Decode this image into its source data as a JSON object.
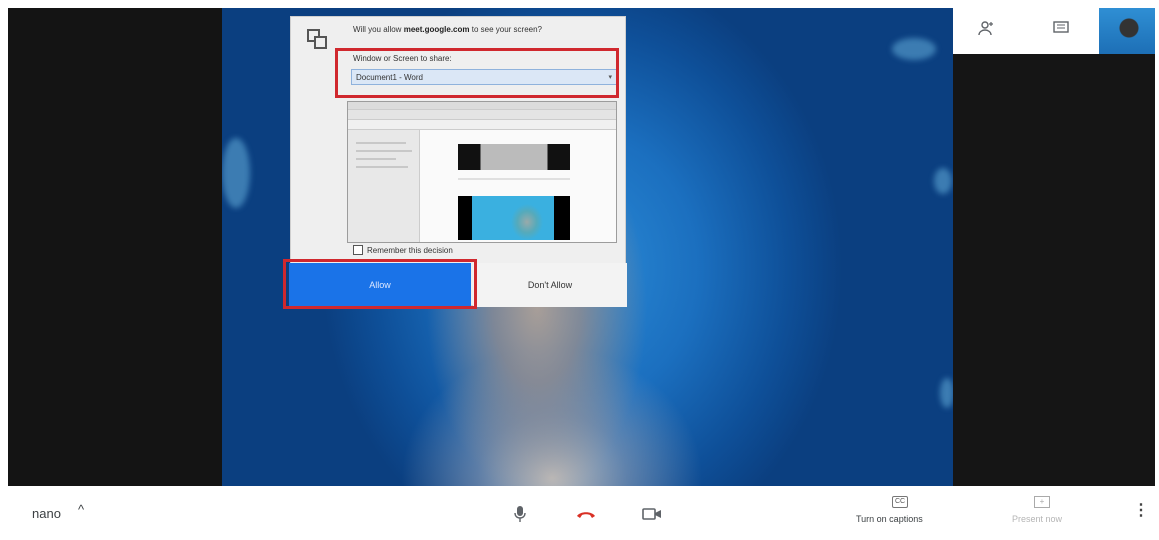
{
  "dialog": {
    "question_prefix": "Will you allow",
    "question_site": "meet.google.com",
    "question_suffix": "to see your screen?",
    "share_label": "Window or Screen to share:",
    "share_selected": "Document1 - Word",
    "remember_label": "Remember this decision",
    "allow_label": "Allow",
    "dont_allow_label": "Don't Allow"
  },
  "top_right": {
    "people_icon": "people-icon",
    "chat_icon": "chat-icon"
  },
  "bottom_bar": {
    "meeting_name": "nano",
    "chevron": "^",
    "mic_icon": "microphone-icon",
    "hangup_icon": "hang-up-icon",
    "camera_icon": "camera-icon",
    "captions_label": "Turn on captions",
    "present_label": "Present now",
    "more_icon": "more-vert-icon"
  },
  "colors": {
    "allow_blue": "#1a73e8",
    "highlight_red": "#d0282e",
    "hangup_red": "#d93025"
  }
}
